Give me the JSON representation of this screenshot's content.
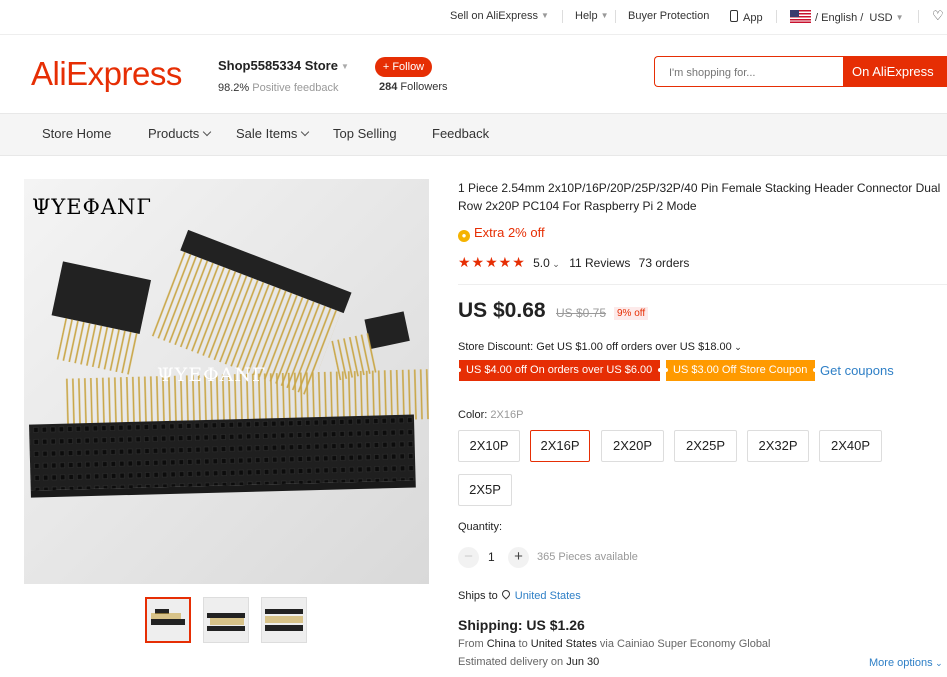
{
  "topbar": {
    "sell": "Sell on AliExpress",
    "help": "Help",
    "buyer_protection": "Buyer Protection",
    "app": "App",
    "language": "/ English /",
    "currency": "USD"
  },
  "header": {
    "logo": "AliExpress",
    "store_name": "Shop5585334 Store",
    "feedback_pct": "98.2%",
    "feedback_text": "Positive feedback",
    "follow_label": "+ Follow",
    "followers_count": "284",
    "followers_text": "Followers",
    "search_placeholder": "I'm shopping for...",
    "search_button": "On AliExpress"
  },
  "nav": {
    "items": [
      "Store Home",
      "Products",
      "Sale Items",
      "Top Selling",
      "Feedback"
    ]
  },
  "gallery": {
    "watermark": "ΨΥΕΦΑΝΓ",
    "thumbnail_count": 3
  },
  "product": {
    "title": "1 Piece 2.54mm 2x10P/16P/20P/25P/32P/40 Pin Female Stacking Header Connector Dual Row 2x20P PC104 For Raspberry Pi 2 Mode",
    "extra_off": "Extra 2% off",
    "rating": "5.0",
    "reviews": "11 Reviews",
    "orders": "73 orders",
    "price": "US $0.68",
    "original_price": "US $0.75",
    "discount": "9% off",
    "store_discount": "Store Discount: Get US $1.00 off orders over US $18.00",
    "coupon_1": "US $4.00 off On orders over US $6.00",
    "coupon_2": "US $3.00 Off Store Coupon",
    "get_coupons": "Get coupons",
    "color_label": "Color:",
    "color_selected": "2X16P",
    "options": [
      "2X10P",
      "2X16P",
      "2X20P",
      "2X25P",
      "2X32P",
      "2X40P",
      "2X5P"
    ],
    "quantity_label": "Quantity:",
    "quantity": "1",
    "available": "365 Pieces available",
    "ships_to_label": "Ships to",
    "ships_to": "United States",
    "shipping": "Shipping: US $1.26",
    "from_label": "From",
    "from_country": "China",
    "to_label": "to",
    "to_country": "United States",
    "via": "via Cainiao Super Economy Global",
    "delivery_label": "Estimated delivery on",
    "delivery_date": "Jun 30",
    "more_options": "More options"
  },
  "colors": {
    "brand": "#e62e04",
    "coupon_orange": "#ff9a00",
    "link": "#2e7fc6"
  }
}
